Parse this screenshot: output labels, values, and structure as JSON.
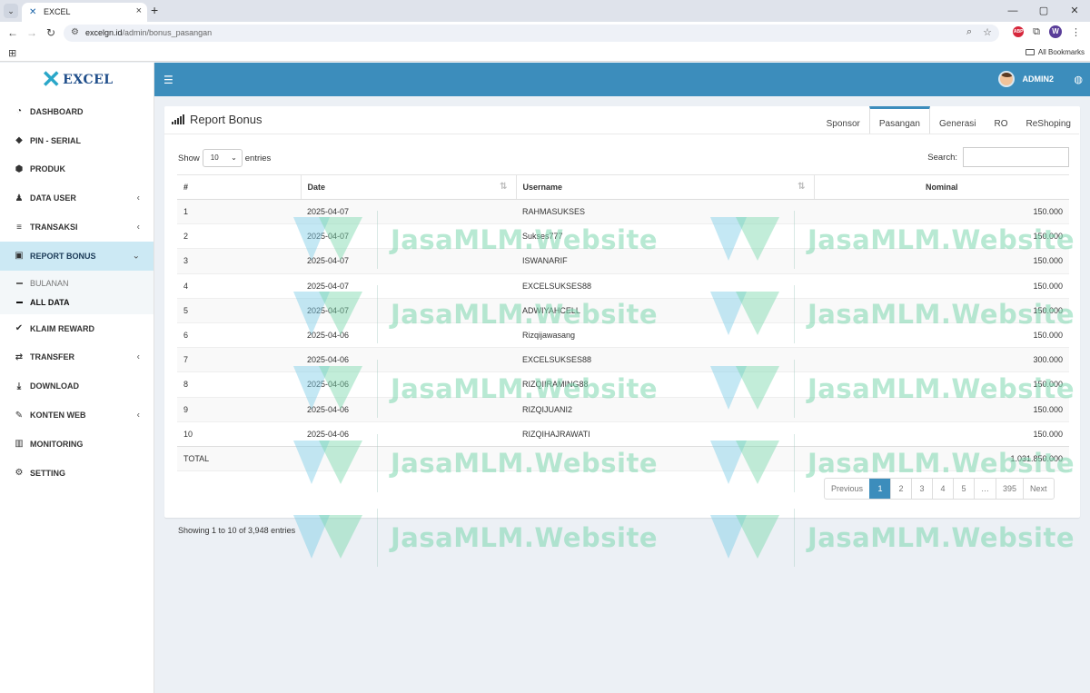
{
  "browser": {
    "tab_title": "EXCEL",
    "url_host": "excelgn.id",
    "url_path": "/admin/bonus_pasangan",
    "bookmarks_label": "All Bookmarks",
    "profile_initial": "W",
    "adblock_label": "ABP"
  },
  "logo": {
    "text": "EXCEL"
  },
  "sidebar": {
    "items": [
      {
        "label": "DASHBOARD",
        "icon": "dashboard-icon",
        "chevron": false
      },
      {
        "label": "PIN - SERIAL",
        "icon": "tag-icon",
        "chevron": false
      },
      {
        "label": "PRODUK",
        "icon": "cube-icon",
        "chevron": false
      },
      {
        "label": "DATA USER",
        "icon": "users-icon",
        "chevron": true
      },
      {
        "label": "TRANSAKSI",
        "icon": "list-icon",
        "chevron": true
      },
      {
        "label": "REPORT BONUS",
        "icon": "money-icon",
        "chevron": true,
        "active": true
      },
      {
        "label": "KLAIM REWARD",
        "icon": "check-icon",
        "chevron": false
      },
      {
        "label": "TRANSFER",
        "icon": "exchange-icon",
        "chevron": true
      },
      {
        "label": "DOWNLOAD",
        "icon": "download-icon",
        "chevron": false
      },
      {
        "label": "KONTEN WEB",
        "icon": "edit-icon",
        "chevron": true
      },
      {
        "label": "MONITORING",
        "icon": "bar-chart-icon",
        "chevron": false
      },
      {
        "label": "SETTING",
        "icon": "cogs-icon",
        "chevron": false
      }
    ],
    "submenu": [
      {
        "label": "BULANAN",
        "current": false
      },
      {
        "label": "ALL DATA",
        "current": true
      }
    ]
  },
  "topbar": {
    "user": "ADMIN2"
  },
  "box": {
    "title": "Report Bonus",
    "tabs": [
      {
        "label": "Sponsor",
        "active": false
      },
      {
        "label": "Pasangan",
        "active": true
      },
      {
        "label": "Generasi",
        "active": false
      },
      {
        "label": "RO",
        "active": false
      },
      {
        "label": "ReShoping",
        "active": false
      }
    ]
  },
  "controls": {
    "show": "Show",
    "entries": "entries",
    "page_size": "10",
    "search_label": "Search:"
  },
  "table": {
    "headers": [
      "#",
      "Date",
      "Username",
      "Nominal"
    ],
    "rows": [
      [
        "1",
        "2025-04-07",
        "RAHMASUKSES",
        "150.000"
      ],
      [
        "2",
        "2025-04-07",
        "Sukses777",
        "150.000"
      ],
      [
        "3",
        "2025-04-07",
        "ISWANARIF",
        "150.000"
      ],
      [
        "4",
        "2025-04-07",
        "EXCELSUKSES88",
        "150.000"
      ],
      [
        "5",
        "2025-04-07",
        "ADWIYAHCELL",
        "150.000"
      ],
      [
        "6",
        "2025-04-06",
        "Rizqijawasang",
        "150.000"
      ],
      [
        "7",
        "2025-04-06",
        "EXCELSUKSES88",
        "300.000"
      ],
      [
        "8",
        "2025-04-06",
        "RIZQIIRAMING88",
        "150.000"
      ],
      [
        "9",
        "2025-04-06",
        "RIZQIJUANI2",
        "150.000"
      ],
      [
        "10",
        "2025-04-06",
        "RIZQIHAJRAWATI",
        "150.000"
      ]
    ],
    "total_label": "TOTAL",
    "total_value": "1.031.850.000"
  },
  "footer": {
    "info": "Showing 1 to 10 of 3,948 entries",
    "pages": [
      "Previous",
      "1",
      "2",
      "3",
      "4",
      "5",
      "…",
      "395",
      "Next"
    ],
    "current_page": "1"
  },
  "watermark": {
    "text": "JasaMLM.Website"
  }
}
